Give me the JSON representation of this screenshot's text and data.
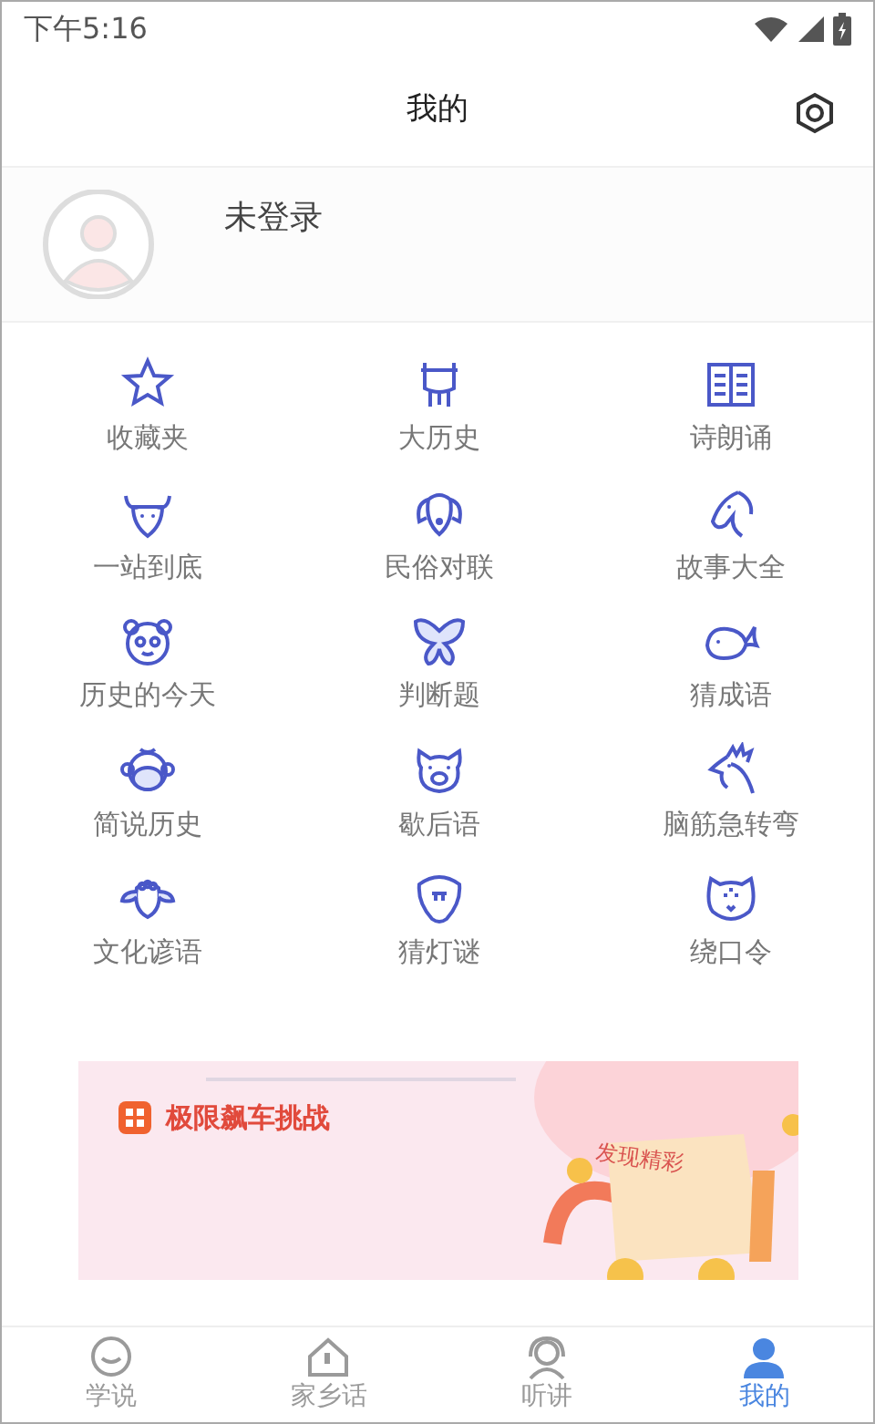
{
  "status_bar": {
    "time": "下午5:16"
  },
  "header": {
    "title": "我的"
  },
  "profile": {
    "name": "未登录"
  },
  "grid": [
    {
      "label": "收藏夹"
    },
    {
      "label": "大历史"
    },
    {
      "label": "诗朗诵"
    },
    {
      "label": "一站到底"
    },
    {
      "label": "民俗对联"
    },
    {
      "label": "故事大全"
    },
    {
      "label": "历史的今天"
    },
    {
      "label": "判断题"
    },
    {
      "label": "猜成语"
    },
    {
      "label": "简说历史"
    },
    {
      "label": "歇后语"
    },
    {
      "label": "脑筋急转弯"
    },
    {
      "label": "文化谚语"
    },
    {
      "label": "猜灯谜"
    },
    {
      "label": "绕口令"
    }
  ],
  "banner": {
    "title": "极限飙车挑战",
    "stamp": "发现精彩"
  },
  "bottom_nav": [
    {
      "label": "学说",
      "selected": false
    },
    {
      "label": "家乡话",
      "selected": false
    },
    {
      "label": "听讲",
      "selected": false
    },
    {
      "label": "我的",
      "selected": true
    }
  ]
}
